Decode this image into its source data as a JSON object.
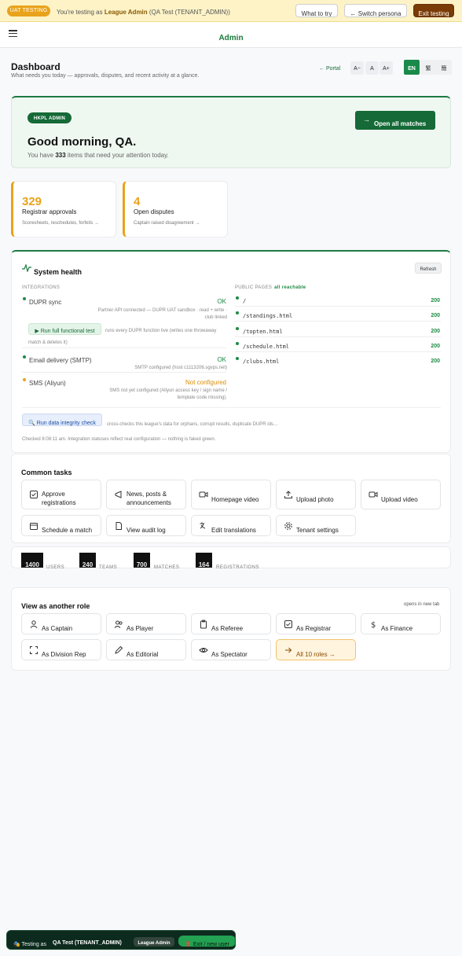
{
  "uat": {
    "pill": "UAT TESTING",
    "prefix": "You're testing as",
    "role": "League Admin",
    "suffix": "(QA Test (TENANT_ADMIN))",
    "what_to_try": "What to try",
    "switch": "← Switch persona",
    "exit": "Exit testing"
  },
  "header": {
    "title": "Admin",
    "menu_icon": "hamburger-menu-icon"
  },
  "page": {
    "title": "Dashboard",
    "subtitle": "What needs you today — approvals, disputes, and recent activity at a glance.",
    "portal_link": "← Portal",
    "font_sizes": [
      "A−",
      "A",
      "A+"
    ],
    "languages": [
      "EN",
      "繁",
      "簡"
    ],
    "active_language": "EN"
  },
  "hero": {
    "badge": "HKPL ADMIN",
    "greeting": "Good morning, QA.",
    "sub_prefix": "You have",
    "sub_count": "333",
    "sub_suffix": "items that need your attention today.",
    "button": "Open all matches"
  },
  "stats": [
    {
      "value": "329",
      "label": "Registrar approvals",
      "desc": "Scoresheets, reschedules, forfeits →"
    },
    {
      "value": "4",
      "label": "Open disputes",
      "desc": "Captain raised disagreement →"
    }
  ],
  "health": {
    "title": "System health",
    "refresh": "Refresh",
    "integrations_label": "INTEGRATIONS",
    "integrations": [
      {
        "name": "DUPR sync",
        "status": "OK",
        "state": "ok",
        "desc": "Partner API connected — DUPR UAT sandbox · read + write · club linked"
      },
      {
        "name": "Email delivery (SMTP)",
        "status": "OK",
        "state": "ok",
        "desc": "SMTP configured (host c1113206.sgvps.net)"
      },
      {
        "name": "SMS (Aliyun)",
        "status": "Not configured",
        "state": "warn",
        "desc": "SMS not yet configured (Aliyun access key / sign name / template code missing)."
      }
    ],
    "functional_test_button": "▶ Run full functional test",
    "functional_test_note_1": "runs every DUPR function live (writes one throwaway",
    "functional_test_note_2": "match & deletes it)",
    "public_pages_label": "PUBLIC PAGES",
    "public_pages_status": "all reachable",
    "public_pages": [
      {
        "path": "/",
        "code": "200"
      },
      {
        "path": "/standings.html",
        "code": "200"
      },
      {
        "path": "/topten.html",
        "code": "200"
      },
      {
        "path": "/schedule.html",
        "code": "200"
      },
      {
        "path": "/clubs.html",
        "code": "200"
      }
    ],
    "integrity_button": "🔍 Run data integrity check",
    "integrity_note": "cross-checks this league's data for orphans, corrupt results, duplicate DUPR ids…",
    "footer": "Checked 8:08:11 am. Integration statuses reflect real configuration — nothing is faked green."
  },
  "tasks": {
    "title": "Common tasks",
    "items": [
      {
        "label": "Approve registrations",
        "icon": "checkbox-icon"
      },
      {
        "label": "News, posts & announcements",
        "icon": "megaphone-icon"
      },
      {
        "label": "Homepage video",
        "icon": "video-camera-icon"
      },
      {
        "label": "Upload photo",
        "icon": "upload-icon"
      },
      {
        "label": "Upload video",
        "icon": "video-upload-icon"
      },
      {
        "label": "Schedule a match",
        "icon": "calendar-icon"
      },
      {
        "label": "View audit log",
        "icon": "document-icon"
      },
      {
        "label": "Edit translations",
        "icon": "translate-icon"
      },
      {
        "label": "Tenant settings",
        "icon": "gear-icon"
      }
    ]
  },
  "counts": [
    {
      "value": "1400",
      "label": "USERS"
    },
    {
      "value": "240",
      "teams": true,
      "label": "TEAMS"
    },
    {
      "value": "700",
      "label": "MATCHES"
    },
    {
      "value": "164",
      "label": "REGISTRATIONS"
    }
  ],
  "roles": {
    "title": "View as another role",
    "note": "opens in new tab",
    "items": [
      {
        "label": "As Captain",
        "icon": "person-icon"
      },
      {
        "label": "As Player",
        "icon": "people-icon"
      },
      {
        "label": "As Referee",
        "icon": "clipboard-icon"
      },
      {
        "label": "As Registrar",
        "icon": "checkbox-icon"
      },
      {
        "label": "As Finance",
        "icon": "dollar-icon"
      },
      {
        "label": "As Division Rep",
        "icon": "expand-icon"
      },
      {
        "label": "As Editorial",
        "icon": "pen-icon"
      },
      {
        "label": "As Spectator",
        "icon": "eye-icon"
      },
      {
        "label": "All 10 roles →",
        "icon": "arrow-right-icon"
      }
    ]
  },
  "toolbar": {
    "prefix": "🎭 Testing as",
    "name": "QA Test (TENANT_ADMIN)",
    "role_chip": "League Admin",
    "exit": "🚪 Exit / new user"
  },
  "colors": {
    "brand_green": "#1d7a43",
    "ok_green": "#1d8a44",
    "amber": "#e9a21b",
    "banner_yellow": "#fdf3c7"
  }
}
